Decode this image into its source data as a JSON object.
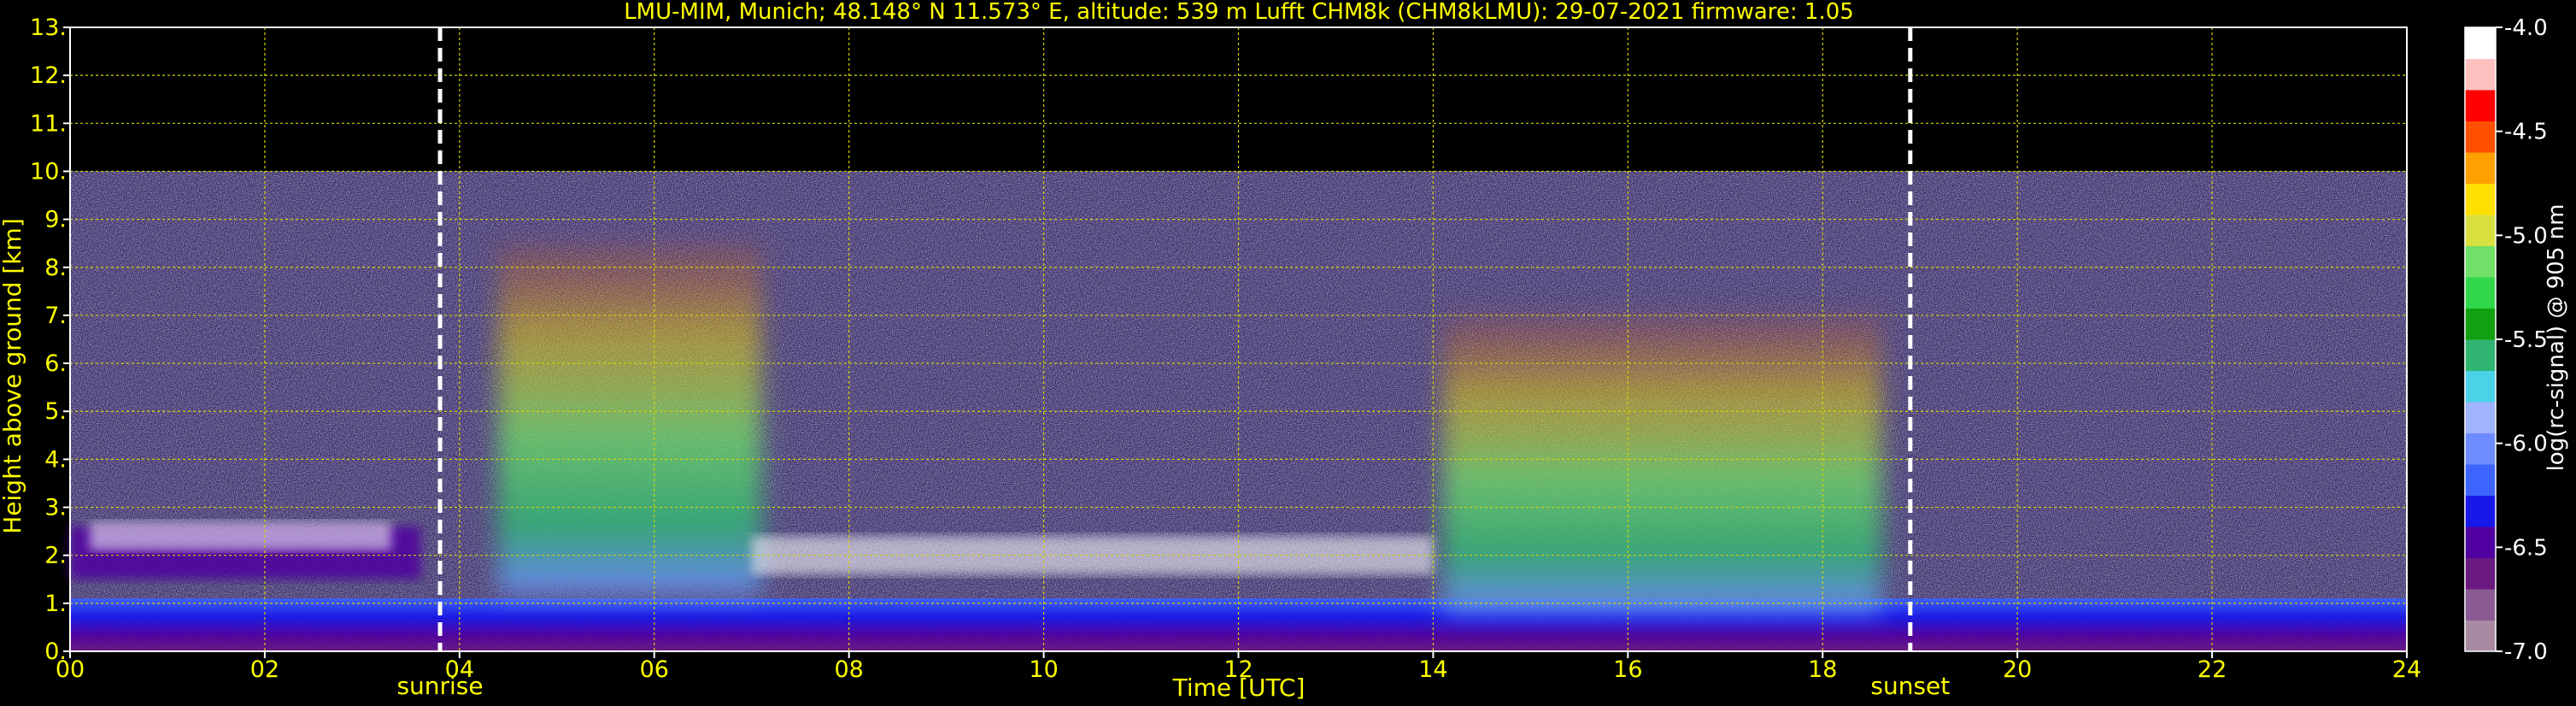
{
  "chart_data": {
    "type": "heatmap",
    "title": "LMU-MIM, Munich; 48.148° N 11.573° E, altitude: 539 m    Lufft CHM8k (CHM8kLMU): 29-07-2021    firmware: 1.05",
    "xlabel": "Time [UTC]",
    "ylabel": "Height above ground [km]",
    "xlim": [
      0,
      24
    ],
    "ylim": [
      0,
      13
    ],
    "x_ticks": [
      "00",
      "02",
      "04",
      "06",
      "08",
      "10",
      "12",
      "14",
      "16",
      "18",
      "20",
      "22",
      "24"
    ],
    "x_tick_values": [
      0,
      2,
      4,
      6,
      8,
      10,
      12,
      14,
      16,
      18,
      20,
      22,
      24
    ],
    "y_ticks": [
      "0.",
      "1.",
      "2.",
      "3.",
      "4.",
      "5.",
      "6.",
      "7.",
      "8.",
      "9.",
      "10.",
      "11.",
      "12.",
      "13."
    ],
    "y_tick_values": [
      0,
      1,
      2,
      3,
      4,
      5,
      6,
      7,
      8,
      9,
      10,
      11,
      12,
      13
    ],
    "grid": true,
    "grid_color": "#d4d400",
    "text_color": "#ffff00",
    "data_top_km": 10,
    "markers": [
      {
        "label": "sunrise",
        "x": 3.8
      },
      {
        "label": "sunset",
        "x": 18.9
      }
    ],
    "colorbar": {
      "label": "log(rc-signal) @ 905 nm",
      "range": [
        -7.0,
        -4.0
      ],
      "ticks": [
        "-4.0",
        "-4.5",
        "-5.0",
        "-5.5",
        "-6.0",
        "-6.5",
        "-7.0"
      ],
      "tick_values": [
        -4.0,
        -4.5,
        -5.0,
        -5.5,
        -6.0,
        -6.5,
        -7.0
      ],
      "colors": [
        "#a88aa2",
        "#8a5a94",
        "#6a1a80",
        "#5000a0",
        "#1818e8",
        "#3c64ff",
        "#6c8cff",
        "#a0b4ff",
        "#4ad2e6",
        "#30b472",
        "#10a010",
        "#30d84a",
        "#70e068",
        "#d8e040",
        "#ffe000",
        "#ffa000",
        "#ff5000",
        "#ff0000",
        "#ffc0c0",
        "#ffffff"
      ]
    },
    "regions": [
      {
        "name": "boundary-layer",
        "x": [
          0,
          24
        ],
        "y": [
          0,
          1.1
        ],
        "level": -6.4
      },
      {
        "name": "aerosol-plume-morning",
        "x": [
          4.4,
          7.1
        ],
        "y": [
          1.2,
          8.5
        ],
        "level": -5.5
      },
      {
        "name": "aerosol-plume-afternoon",
        "x": [
          14.1,
          18.6
        ],
        "y": [
          0.8,
          7.0
        ],
        "level": -5.7
      },
      {
        "name": "residual-layer-night",
        "x": [
          0,
          3.6
        ],
        "y": [
          1.5,
          2.6
        ],
        "level": -6.5
      },
      {
        "name": "cloud-layer-night",
        "x": [
          0.2,
          3.3
        ],
        "y": [
          2.1,
          2.7
        ],
        "level": -4.0
      },
      {
        "name": "cloud-layer-midday",
        "x": [
          7.0,
          14.0
        ],
        "y": [
          1.6,
          2.4
        ],
        "level": -4.0
      }
    ]
  }
}
